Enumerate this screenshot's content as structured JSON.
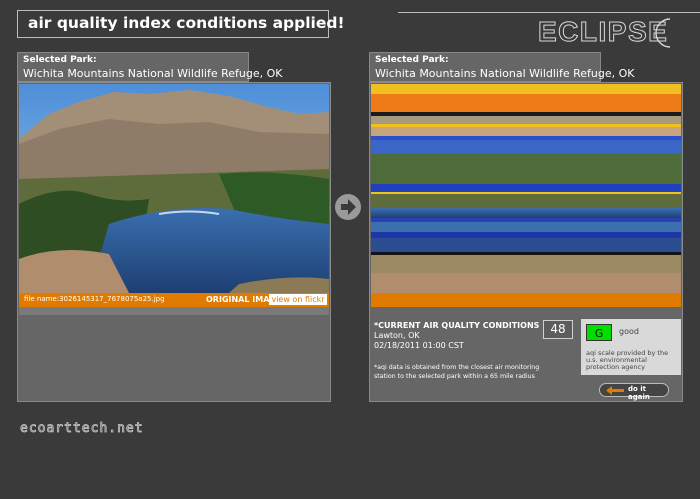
{
  "banner": {
    "title": "air quality index conditions applied!"
  },
  "logo": {
    "text": "ECLIPSE"
  },
  "left": {
    "tab_label": "Selected Park:",
    "park": "Wichita Mountains National Wildlife Refuge, OK",
    "file_name": "file name:3026145317_7678075a25.jpg",
    "original_label": "ORIGINAL IMAGE",
    "flickr_button": "view on flickr"
  },
  "right": {
    "tab_label": "Selected Park:",
    "park": "Wichita Mountains National Wildlife Refuge, OK",
    "conditions_title": "*CURRENT AIR QUALITY CONDITIONS",
    "location": "Lawton, OK",
    "datetime": "02/18/2011 01:00 CST",
    "aqi_value": "48",
    "grade": "G",
    "grade_label": "good",
    "scale_note": "aqi scale provided by the u.s. environmental protection agency",
    "note": "*aqi data is obtained from the closest air monitoring station to the selected park within a 65 mile radius",
    "do_again": "do it again"
  },
  "footer": {
    "site": "ecoarttech.net"
  },
  "colors": {
    "accent": "#e07b00",
    "good": "#00dd00",
    "background": "#3a3a3a"
  },
  "icons": [
    "arrow-right-icon",
    "arrow-left-icon",
    "crescent-moon-icon"
  ]
}
